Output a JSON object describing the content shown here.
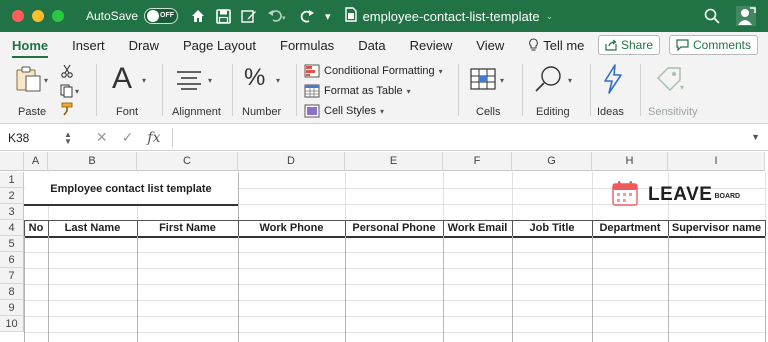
{
  "window": {
    "autosave_label": "AutoSave",
    "autosave_state": "OFF",
    "file_name": "employee-contact-list-template",
    "accent": "#217346"
  },
  "tabs": [
    {
      "label": "Home",
      "active": true
    },
    {
      "label": "Insert"
    },
    {
      "label": "Draw"
    },
    {
      "label": "Page Layout"
    },
    {
      "label": "Formulas"
    },
    {
      "label": "Data"
    },
    {
      "label": "Review"
    },
    {
      "label": "View"
    }
  ],
  "tell_me": "Tell me",
  "share_label": "Share",
  "comments_label": "Comments",
  "ribbon": {
    "paste": "Paste",
    "font": "Font",
    "alignment": "Alignment",
    "number": "Number",
    "conditional_formatting": "Conditional Formatting",
    "format_as_table": "Format as Table",
    "cell_styles": "Cell Styles",
    "cells": "Cells",
    "editing": "Editing",
    "ideas": "Ideas",
    "sensitivity": "Sensitivity"
  },
  "formula_bar": {
    "name_box": "K38",
    "fx": "fx",
    "value": ""
  },
  "sheet": {
    "columns": [
      "A",
      "B",
      "C",
      "D",
      "E",
      "F",
      "G",
      "H",
      "I"
    ],
    "rows": [
      "1",
      "2",
      "3",
      "4",
      "5",
      "6",
      "7",
      "8",
      "9",
      "10"
    ],
    "title": "Employee contact list template",
    "headers": [
      "No",
      "Last Name",
      "First Name",
      "Work Phone",
      "Personal Phone",
      "Work Email",
      "Job Title",
      "Department",
      "Supervisor name"
    ]
  },
  "logo": {
    "main": "LEAVE",
    "sub": "BOARD"
  }
}
